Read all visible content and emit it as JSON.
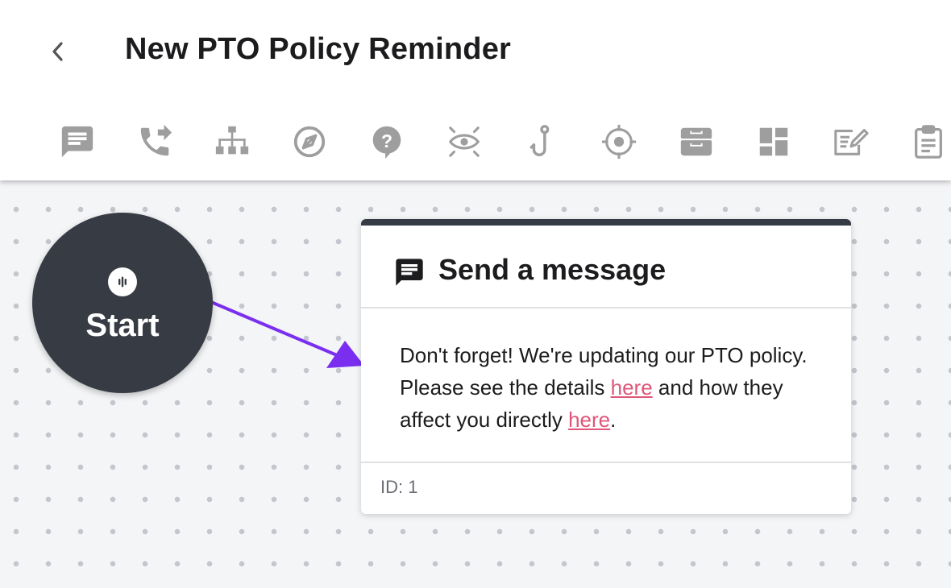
{
  "header": {
    "title": "New PTO Policy Reminder",
    "back_icon": "chevron-left-icon"
  },
  "toolbar": {
    "icon_color": "#9e9e9e",
    "tools": [
      {
        "name": "message-icon"
      },
      {
        "name": "phone-forward-icon"
      },
      {
        "name": "sitemap-icon"
      },
      {
        "name": "compass-icon"
      },
      {
        "name": "question-bubble-icon"
      },
      {
        "name": "eye-icon"
      },
      {
        "name": "hook-icon"
      },
      {
        "name": "crosshair-icon"
      },
      {
        "name": "inbox-tray-icon"
      },
      {
        "name": "dashboard-icon"
      },
      {
        "name": "form-edit-icon"
      },
      {
        "name": "clipboard-icon"
      }
    ]
  },
  "flow": {
    "start": {
      "label": "Start",
      "icon": "voice-bars-icon",
      "color": "#373c44"
    },
    "connector_color": "#7a2ff0",
    "message_card": {
      "title": "Send a message",
      "icon": "message-icon",
      "body": {
        "part1": "Don't forget! We're updating our PTO policy. Please see the details ",
        "link1": "here",
        "part2": " and how they affect you directly ",
        "link2": "here",
        "part3": "."
      },
      "link_color": "#e05679",
      "footer_id": "ID: 1"
    }
  }
}
